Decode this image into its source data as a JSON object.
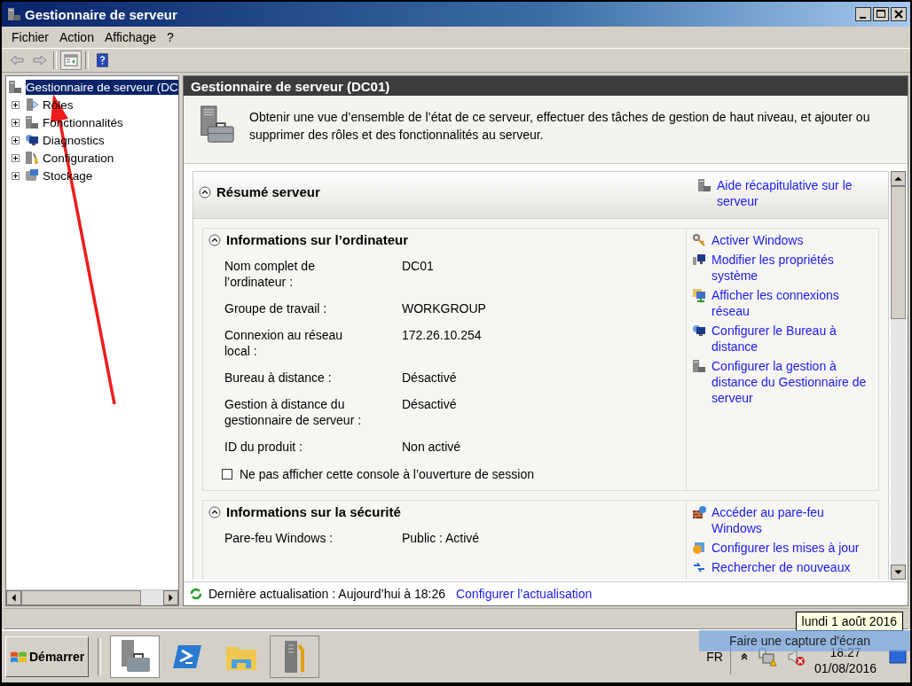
{
  "window": {
    "title": "Gestionnaire de serveur"
  },
  "menu": [
    "Fichier",
    "Action",
    "Affichage",
    "?"
  ],
  "tree": {
    "root": {
      "label": "Gestionnaire de serveur (DC",
      "selected": true
    },
    "items": [
      {
        "label": "Rôles",
        "expanded": false
      },
      {
        "label": "Fonctionnalités",
        "expanded": false
      },
      {
        "label": "Diagnostics",
        "expanded": false
      },
      {
        "label": "Configuration",
        "expanded": false
      },
      {
        "label": "Stockage",
        "expanded": false
      }
    ]
  },
  "panel": {
    "title": "Gestionnaire de serveur (DC01)",
    "description": "Obtenir une vue d’ensemble de l’état de ce serveur, effectuer des tâches de gestion de haut niveau, et ajouter ou supprimer des rôles et des fonctionnalités au serveur.",
    "summary": {
      "title": "Résumé serveur",
      "expanded": true,
      "help_link": "Aide récapitulative sur le serveur"
    },
    "computer_info": {
      "title": "Informations sur l’ordinateur",
      "expanded": true,
      "properties": [
        {
          "label": "Nom complet de l’ordinateur :",
          "value": "DC01"
        },
        {
          "label": "Groupe de travail :",
          "value": "WORKGROUP"
        },
        {
          "label": "Connexion au réseau local :",
          "value": "172.26.10.254"
        },
        {
          "label": "Bureau à distance :",
          "value": "Désactivé"
        },
        {
          "label": "Gestion à distance du gestionnaire de serveur :",
          "value": "Désactivé"
        },
        {
          "label": "ID du produit :",
          "value": "Non activé"
        }
      ],
      "links": [
        "Activer Windows",
        "Modifier les propriétés système",
        "Afficher les connexions réseau",
        "Configurer le Bureau à distance",
        "Configurer la gestion à distance du Gestionnaire de serveur"
      ],
      "checkbox": {
        "label": "Ne pas afficher cette console à l’ouverture de session",
        "checked": false
      }
    },
    "security_info": {
      "title": "Informations sur la sécurité",
      "expanded": true,
      "properties": [
        {
          "label": "Pare-feu Windows :",
          "value": "Public : Activé"
        }
      ],
      "links": [
        "Accéder au pare-feu Windows",
        "Configurer les mises à jour",
        "Rechercher de nouveaux"
      ]
    },
    "footer": {
      "refresh_text": "Dernière actualisation : Aujourd’hui à 18:26",
      "configure_link": "Configurer l’actualisation"
    }
  },
  "tooltip_date": "lundi 1 août 2016",
  "taskbar": {
    "start_label": "Démarrer",
    "apps": [
      {
        "selected": true
      },
      {
        "selected": false
      },
      {
        "selected": false
      },
      {
        "selected": false
      }
    ],
    "language": "FR",
    "time": "18:27",
    "date": "01/08/2016"
  },
  "capture_hint": "Faire une capture d'écran"
}
